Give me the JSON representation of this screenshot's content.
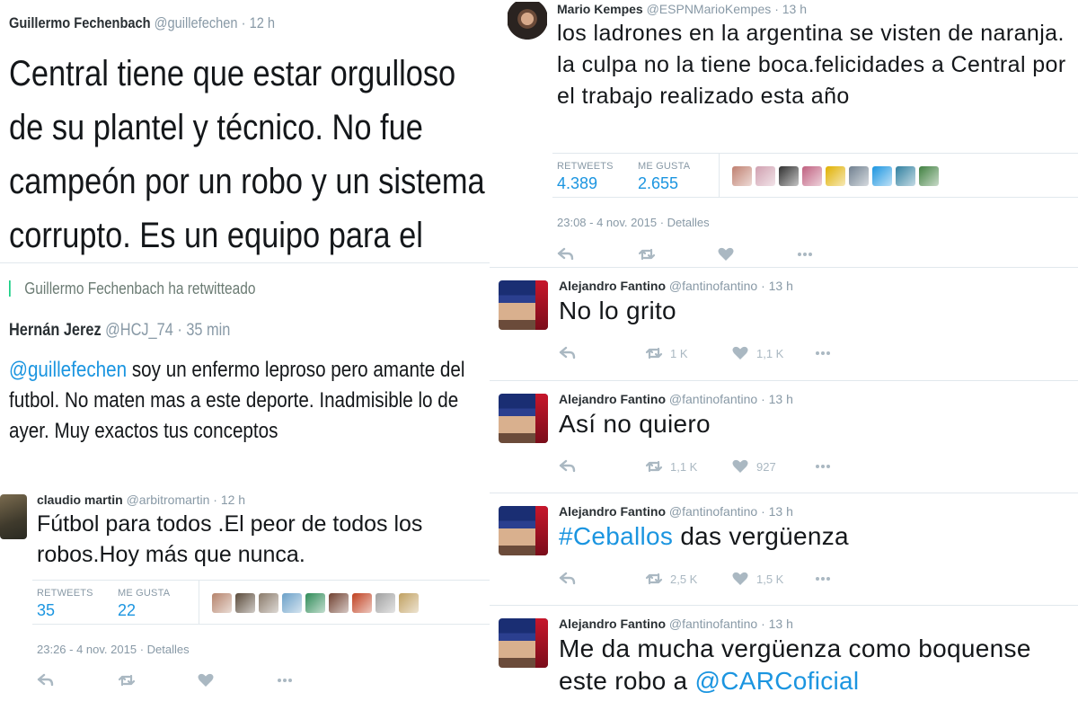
{
  "guillermo": {
    "name": "Guillermo Fechenbach",
    "handle": "@guillefechen",
    "time": "12 h",
    "text": "Central tiene que estar orgulloso de su plantel y técnico. No fue campeón por un robo y un sistema corrupto. Es un equipo para el orgullo."
  },
  "retweet": {
    "context": "Guillermo Fechenbach ha retwitteado",
    "name": "Hernán Jerez",
    "handle": "@HCJ_74",
    "time": "35 min",
    "mention": "@guillefechen",
    "text": " soy un enfermo leproso pero amante del futbol. No maten mas a este deporte. Inadmisible lo de ayer. Muy exactos tus conceptos"
  },
  "claudio": {
    "name": "claudio martin",
    "handle": "@arbitromartin",
    "time": "12 h",
    "text": "Fútbol para todos .El peor de todos los robos.Hoy más que nunca.",
    "retweets_label": "RETWEETS",
    "retweets": "35",
    "likes_label": "ME GUSTA",
    "likes": "22",
    "faces": [
      "#b5836b",
      "#5a4a3a",
      "#8a7a6a",
      "#6aa0c8",
      "#2e8b57",
      "#704030",
      "#c04020",
      "#a0a0a0",
      "#c0a060"
    ],
    "date": "23:26 - 4 nov. 2015",
    "details": "Detalles"
  },
  "kempes": {
    "name": "Mario Kempes",
    "handle": "@ESPNMarioKempes",
    "time": "13 h",
    "text": "los ladrones en la argentina se visten de naranja. la culpa no la tiene boca.felicidades a Central por el trabajo realizado esta año",
    "retweets_label": "RETWEETS",
    "retweets": "4.389",
    "likes_label": "ME GUSTA",
    "likes": "2.655",
    "faces": [
      "#c08070",
      "#d0a0b0",
      "#303030",
      "#c06080",
      "#e0b000",
      "#708090",
      "#1b95e0",
      "#3080a0",
      "#408040"
    ],
    "date": "23:08 - 4 nov. 2015",
    "details": "Detalles"
  },
  "fantino": [
    {
      "name": "Alejandro Fantino",
      "handle": "@fantinofantino",
      "time": "13 h",
      "text": "No lo grito",
      "rt": "1 K",
      "likes": "1,1 K"
    },
    {
      "name": "Alejandro Fantino",
      "handle": "@fantinofantino",
      "time": "13 h",
      "text": "Así no quiero",
      "rt": "1,1 K",
      "likes": "927"
    },
    {
      "name": "Alejandro Fantino",
      "handle": "@fantinofantino",
      "time": "13 h",
      "hashtag": "#Ceballos",
      "text": " das vergüenza",
      "rt": "2,5 K",
      "likes": "1,5 K"
    },
    {
      "name": "Alejandro Fantino",
      "handle": "@fantinofantino",
      "time": "13 h",
      "text": "Me da mucha vergüenza como boquense este robo a ",
      "link": "@CARCoficial"
    }
  ],
  "colors": {
    "link": "#1b95e0",
    "muted": "#8899a6",
    "retweet_green": "#19cf86"
  }
}
